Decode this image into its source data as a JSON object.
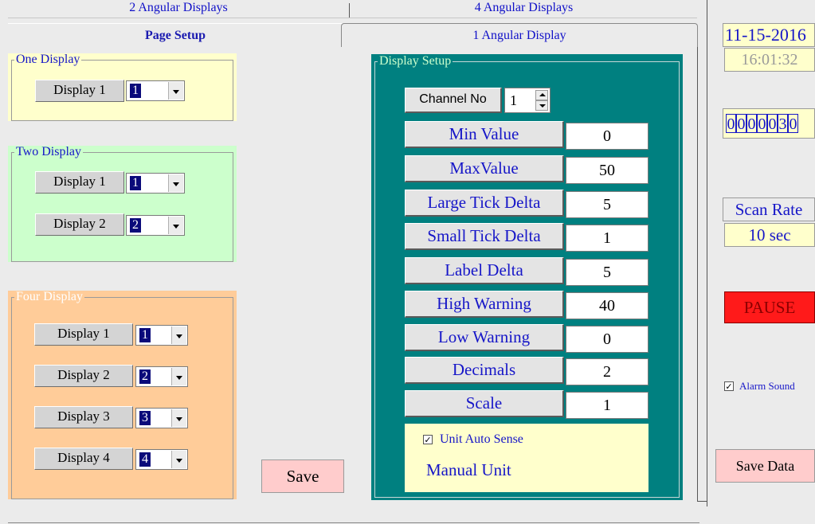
{
  "tabs": {
    "row1": [
      "2 Angular Displays",
      "4 Angular  Displays"
    ],
    "row2": [
      "Page Setup",
      "1 Angular Display"
    ]
  },
  "one_display": {
    "legend": "One Display",
    "rows": [
      {
        "label": "Display 1",
        "value": "1"
      }
    ]
  },
  "two_display": {
    "legend": "Two Display",
    "rows": [
      {
        "label": "Display 1",
        "value": "1"
      },
      {
        "label": "Display 2",
        "value": "2"
      }
    ]
  },
  "four_display": {
    "legend": "Four Display",
    "rows": [
      {
        "label": "Display 1",
        "value": "1"
      },
      {
        "label": "Display 2",
        "value": "2"
      },
      {
        "label": "Display 3",
        "value": "3"
      },
      {
        "label": "Display 4",
        "value": "4"
      }
    ]
  },
  "save_label": "Save",
  "display_setup": {
    "legend": "Display Setup",
    "channel_label": "Channel No",
    "channel_value": "1",
    "fields": [
      {
        "label": "Min Value",
        "value": "0"
      },
      {
        "label": "MaxValue",
        "value": "50"
      },
      {
        "label": "Large Tick Delta",
        "value": "5"
      },
      {
        "label": "Small Tick Delta",
        "value": "1"
      },
      {
        "label": "Label Delta",
        "value": "5"
      },
      {
        "label": "High Warning",
        "value": "40"
      },
      {
        "label": "Low Warning",
        "value": "0"
      },
      {
        "label": "Decimals",
        "value": "2"
      },
      {
        "label": "Scale",
        "value": "1"
      }
    ],
    "unit_auto_sense": "Unit Auto Sense",
    "manual_unit": "Manual Unit"
  },
  "side": {
    "date": "11-15-2016",
    "time": "16:01:32",
    "counter": [
      "0",
      "0",
      "0",
      "0",
      "0",
      "3",
      "0"
    ],
    "scan_rate_label": "Scan Rate",
    "scan_rate_value": "10 sec",
    "pause_label": "PAUSE",
    "alarm_sound": "Alarm Sound",
    "save_data": "Save Data"
  },
  "colors": {
    "one_display_bg": "#ffffcc",
    "two_display_bg": "#ccffcc",
    "four_display_bg": "#ffcc99",
    "setup_bg": "#008080",
    "pause_bg": "#ff1a1a",
    "save_bg": "#ffcccc"
  }
}
